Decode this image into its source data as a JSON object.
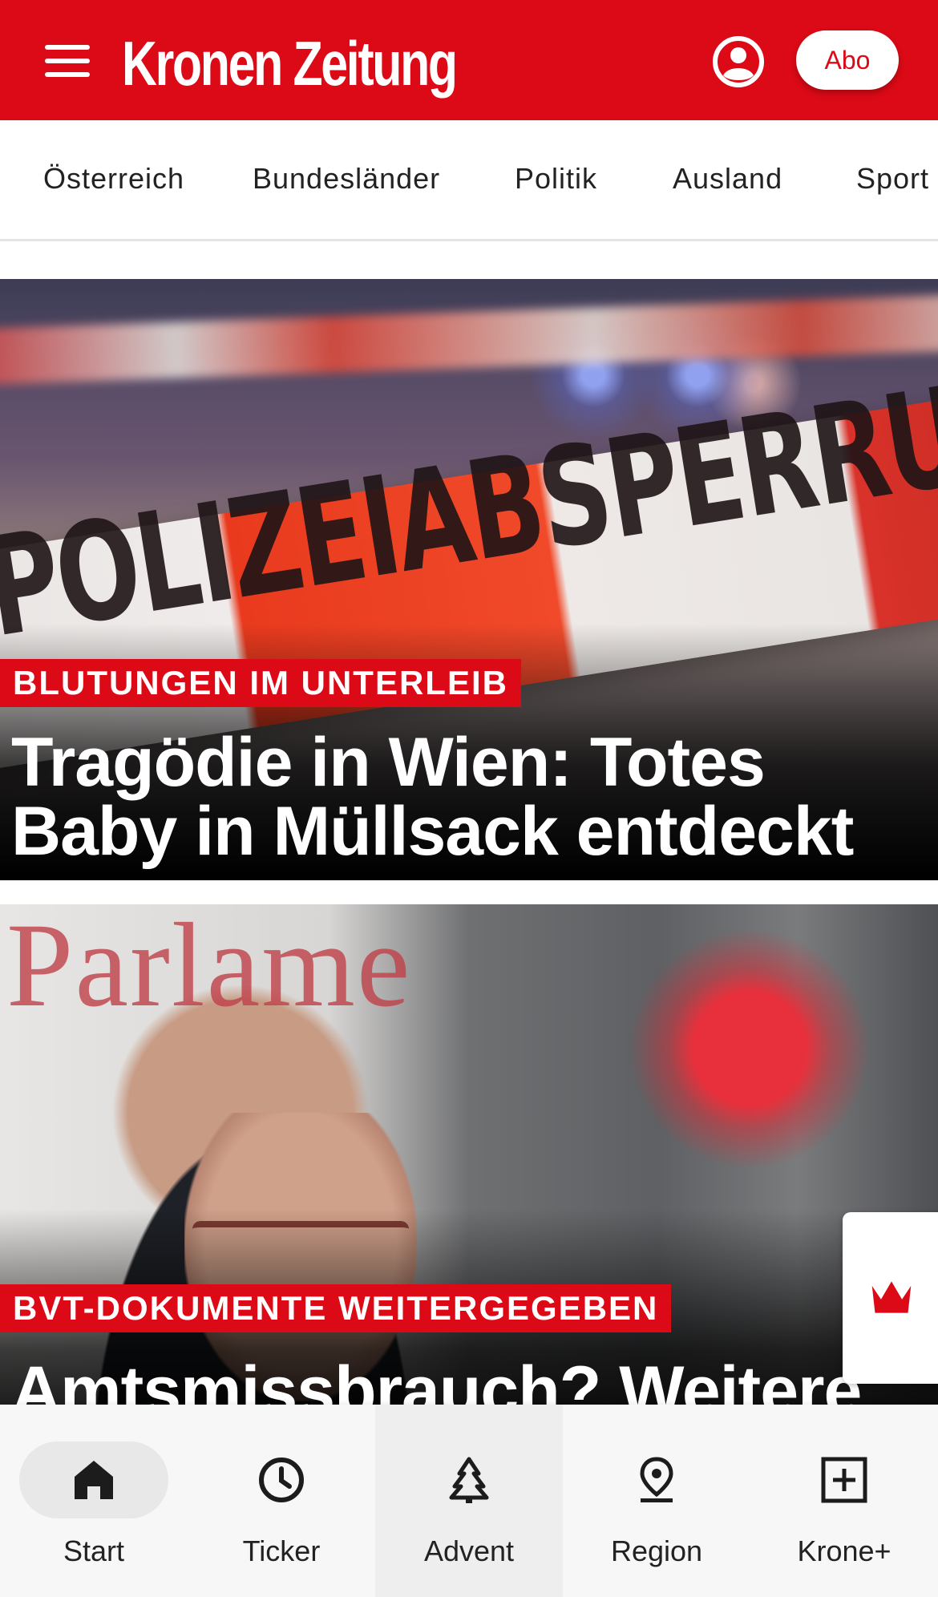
{
  "header": {
    "logo_text": "Kronen Zeitung",
    "abo_label": "Abo",
    "brand_color": "#db0a16"
  },
  "categories": [
    "Österreich",
    "Bundesländer",
    "Politik",
    "Ausland",
    "Sport"
  ],
  "articles": [
    {
      "kicker": "BLUTUNGEN IM UNTERLEIB",
      "headline": "Tragödie in Wien: Totes Baby in Müllsack entdeckt",
      "image_text": "POLIZEIABSPERRUNG"
    },
    {
      "kicker": "BVT-DOKUMENTE WEITERGEGEBEN",
      "headline": "Amtsmissbrauch? Weitere",
      "image_text": "Parlame"
    }
  ],
  "tabbar": {
    "items": [
      {
        "label": "Start",
        "icon": "home-icon"
      },
      {
        "label": "Ticker",
        "icon": "clock-icon"
      },
      {
        "label": "Advent",
        "icon": "tree-icon"
      },
      {
        "label": "Region",
        "icon": "location-pin-icon"
      },
      {
        "label": "Krone+",
        "icon": "plus-box-icon"
      }
    ]
  }
}
